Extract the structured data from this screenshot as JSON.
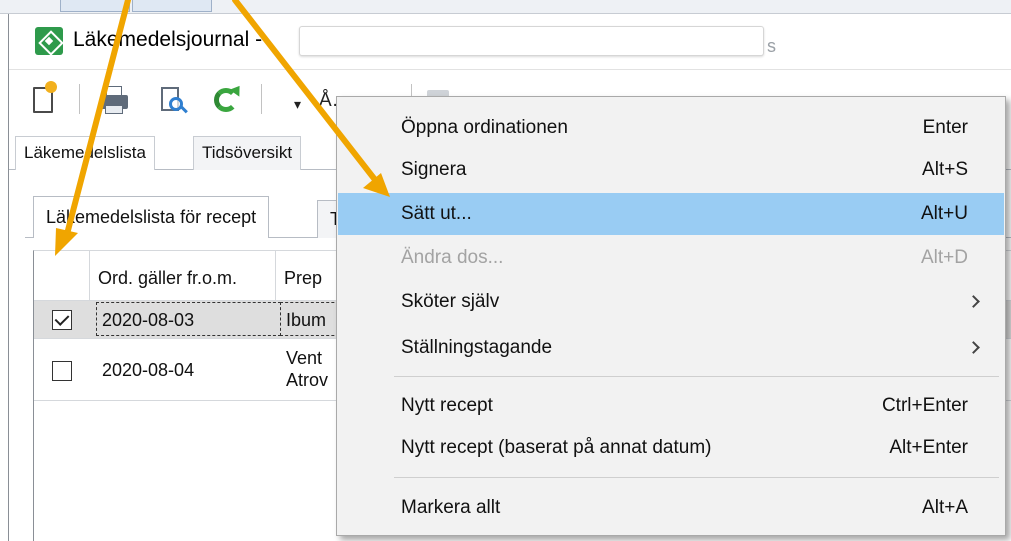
{
  "window": {
    "title": "Läkemedelsjournal -",
    "title_suffix": "s"
  },
  "toolbar": {
    "dropdown_glyph": "▾",
    "partial_label": "Å…"
  },
  "tabs_row1": [
    {
      "label": "Läkemedelslista"
    },
    {
      "label": "Tidsöversikt"
    }
  ],
  "tabs_row2": [
    {
      "label": "Läkemedelslista för recept"
    },
    {
      "label": "T"
    }
  ],
  "grid": {
    "columns": [
      {
        "label": ""
      },
      {
        "label": "Ord. gäller fr.o.m."
      },
      {
        "label": "Prep"
      }
    ],
    "rows": [
      {
        "checked": true,
        "date": "2020-08-03",
        "prep": "Ibum",
        "prep2": ""
      },
      {
        "checked": false,
        "date": "2020-08-04",
        "prep": "Vent",
        "prep2": "Atrov"
      }
    ]
  },
  "context_menu": {
    "items": [
      {
        "label": "Öppna ordinationen",
        "shortcut": "Enter"
      },
      {
        "label": "Signera",
        "shortcut": "Alt+S"
      },
      {
        "label": "Sätt ut...",
        "shortcut": "Alt+U",
        "highlighted": true
      },
      {
        "label": "Ändra dos...",
        "shortcut": "Alt+D",
        "disabled": true
      },
      {
        "label": "Sköter själv",
        "submenu": true
      },
      {
        "label": "Ställningstagande",
        "submenu": true
      },
      {
        "label": "Nytt recept",
        "shortcut": "Ctrl+Enter"
      },
      {
        "label": "Nytt recept (baserat på annat datum)",
        "shortcut": "Alt+Enter"
      },
      {
        "label": "Markera allt",
        "shortcut": "Alt+A"
      }
    ]
  },
  "colors": {
    "menu_highlight": "#99ccf3",
    "arrow": "#f0a500",
    "app_icon": "#2e9a4b"
  }
}
